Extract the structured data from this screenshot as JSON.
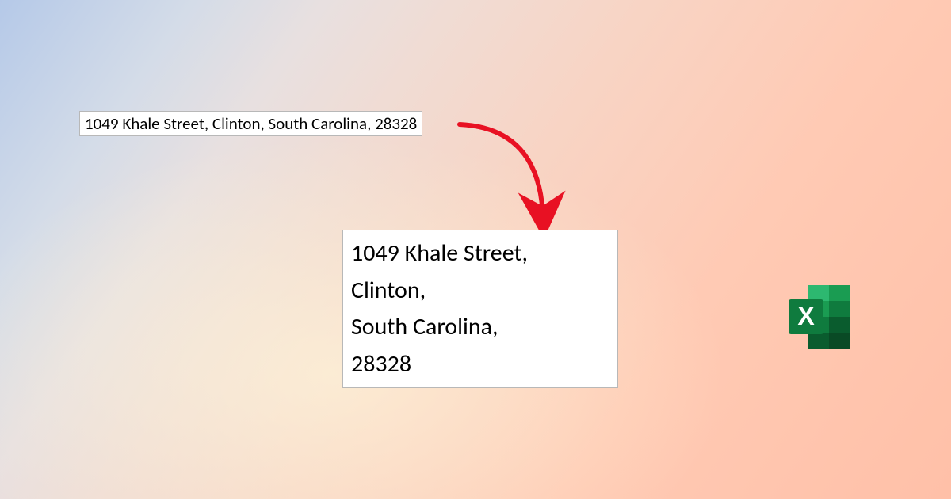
{
  "source_cell": "1049 Khale Street, Clinton, South Carolina, 28328",
  "result_cell": {
    "line1": "1049 Khale Street,",
    "line2": "Clinton,",
    "line3": "South Carolina,",
    "line4": "28328"
  },
  "arrow_color": "#e81123",
  "excel_colors": {
    "dark": "#0f7b3e",
    "mid": "#1a9c52",
    "light": "#2db870",
    "darkest": "#0a5c2e"
  },
  "icon_letter": "X"
}
